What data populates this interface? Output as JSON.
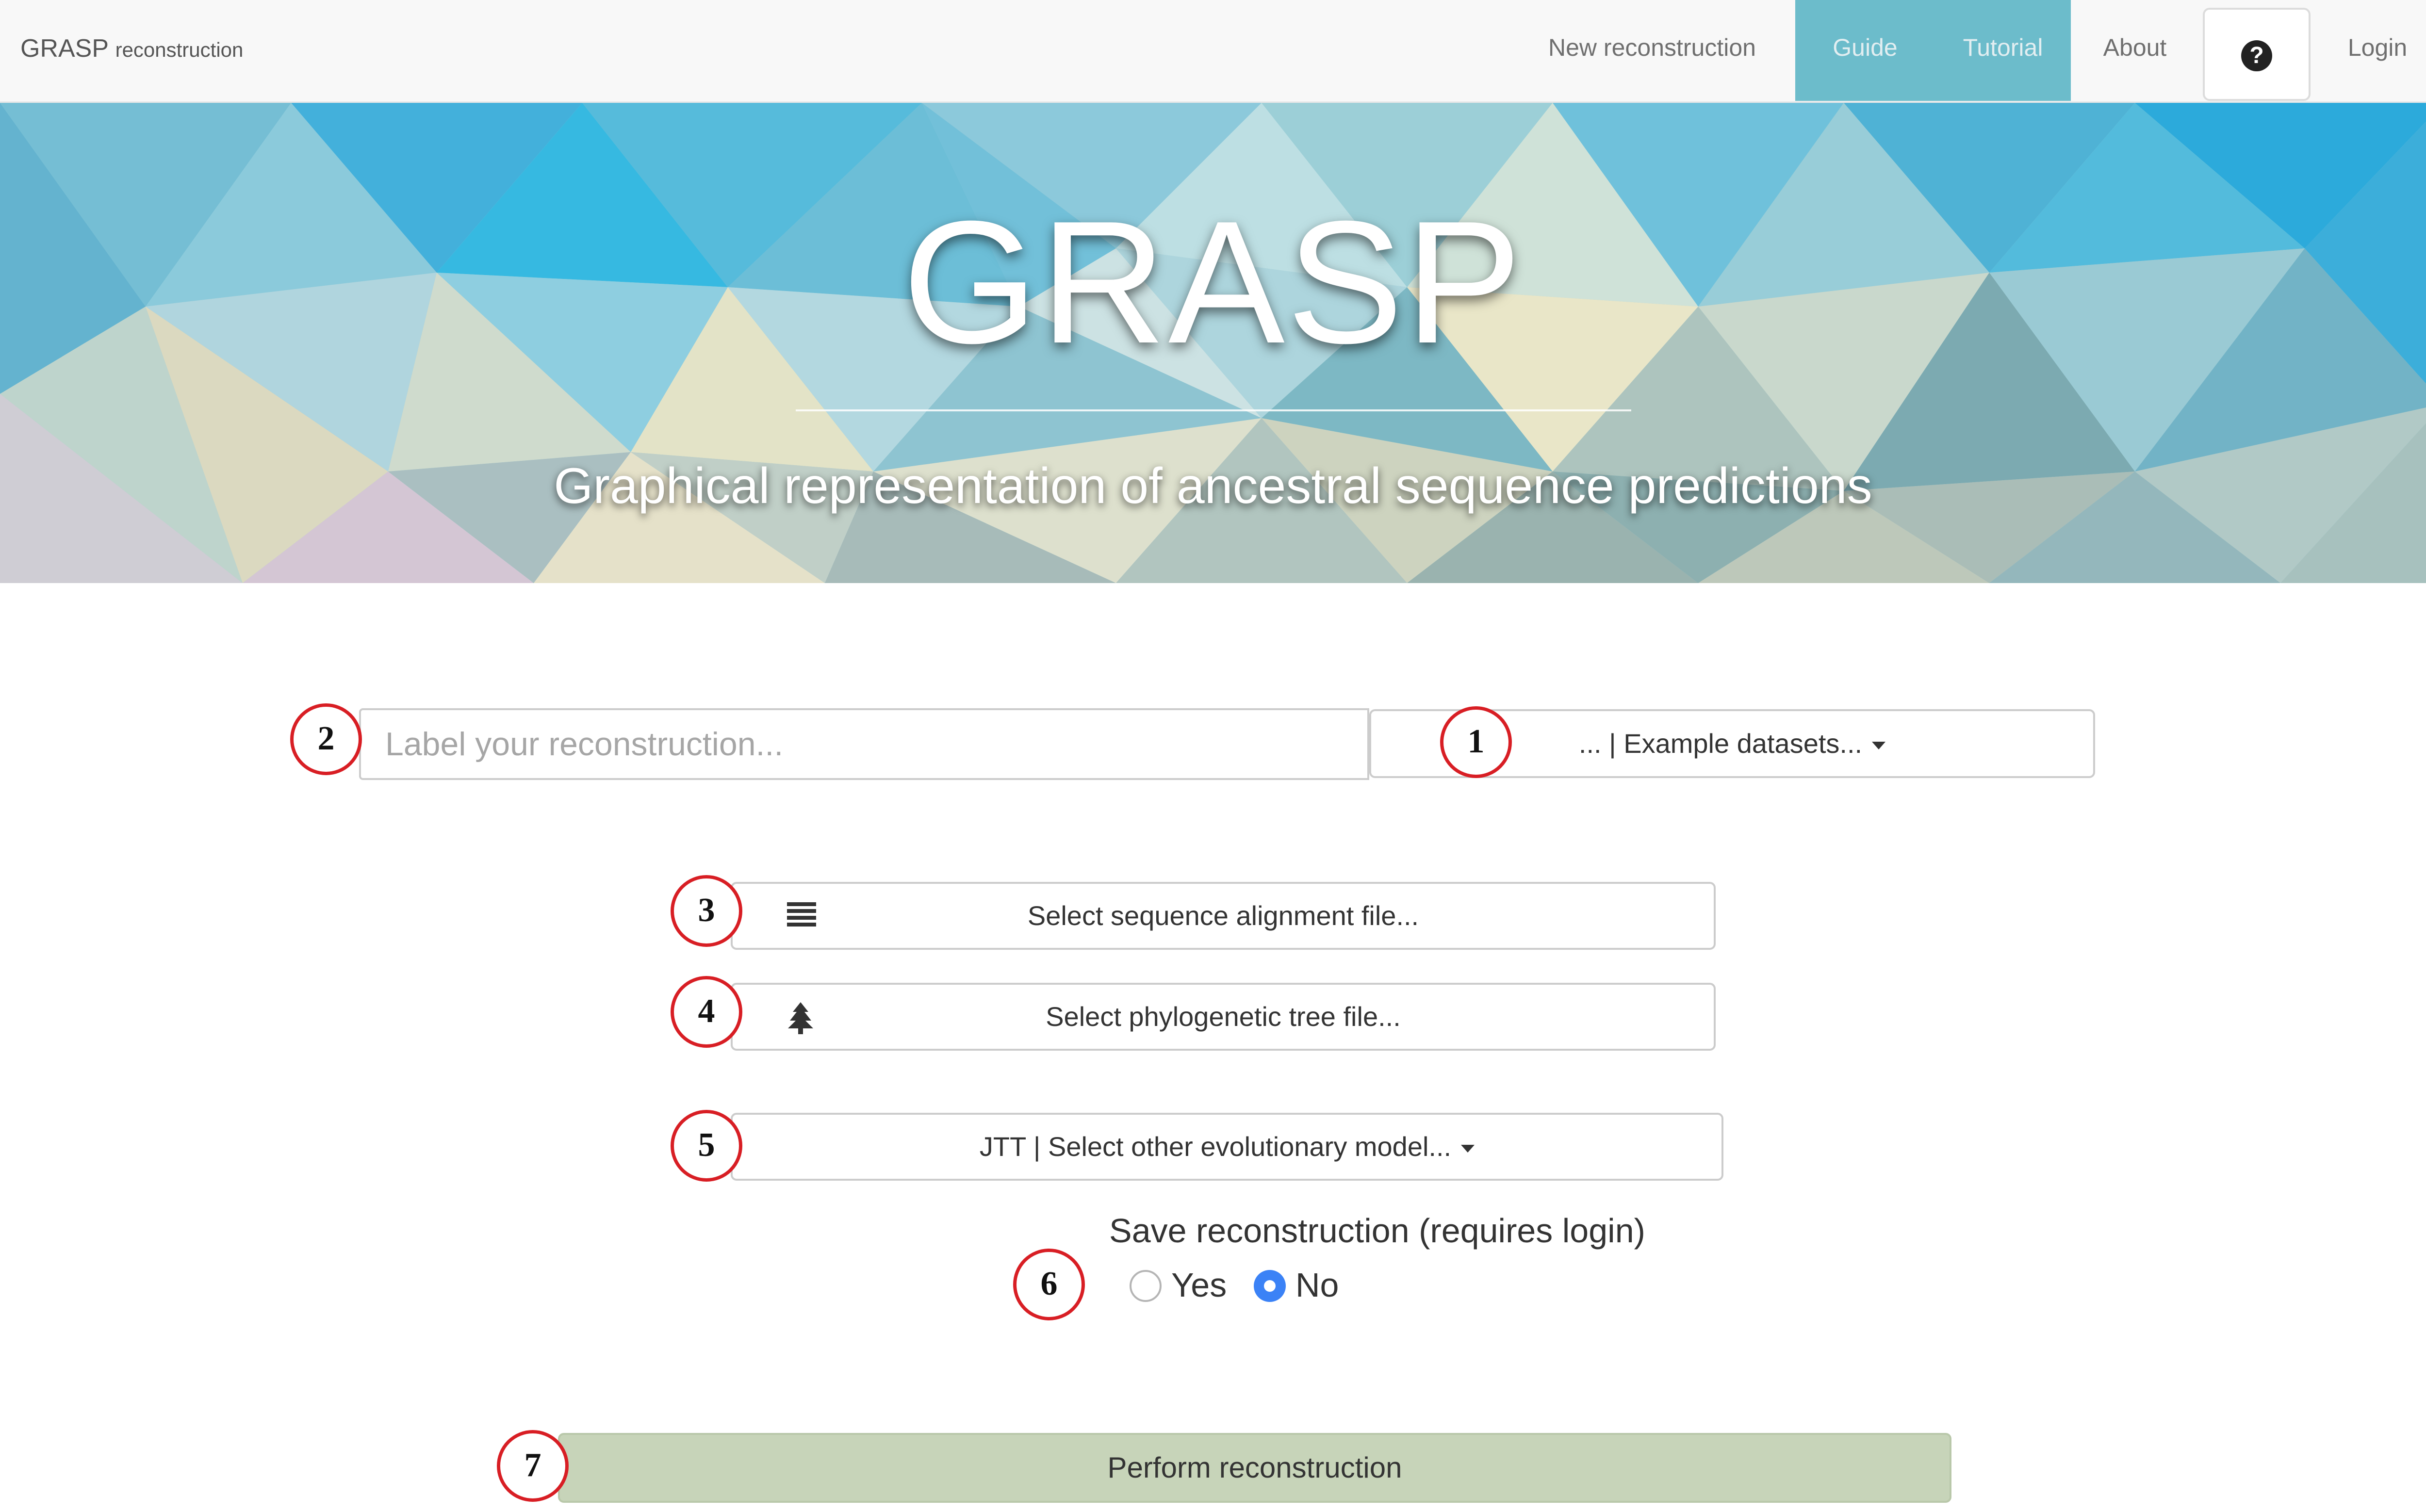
{
  "navbar": {
    "brand_main": "GRASP",
    "brand_sub": "reconstruction",
    "items": [
      {
        "label": "New reconstruction",
        "active": false
      },
      {
        "label": "Guide",
        "active": true
      },
      {
        "label": "Tutorial",
        "active": true
      },
      {
        "label": "About",
        "active": false
      }
    ],
    "help_icon": "question-circle-icon",
    "login_label": "Login"
  },
  "hero": {
    "title": "GRASP",
    "subtitle": "Graphical representation of ancestral sequence predictions"
  },
  "form": {
    "label_placeholder": "Label your reconstruction...",
    "label_value": "",
    "example_datasets_label": "... | Example datasets...",
    "alignment_file_label": "Select sequence alignment file...",
    "alignment_icon": "align-justify-icon",
    "tree_file_label": "Select phylogenetic tree file...",
    "tree_icon": "tree-icon",
    "model_label": "JTT | Select other evolutionary model...",
    "save_label": "Save reconstruction (requires login)",
    "save_options": [
      {
        "label": "Yes",
        "selected": false
      },
      {
        "label": "No",
        "selected": true
      }
    ],
    "perform_label": "Perform reconstruction"
  },
  "annotations": [
    "1",
    "2",
    "3",
    "4",
    "5",
    "6",
    "7"
  ],
  "colors": {
    "navbar_bg": "#f8f8f8",
    "nav_active_bg": "#6cbccb",
    "perform_btn_bg": "#c7d4b9",
    "annotation_ring": "#d81e24",
    "radio_selected": "#3b82f6"
  }
}
